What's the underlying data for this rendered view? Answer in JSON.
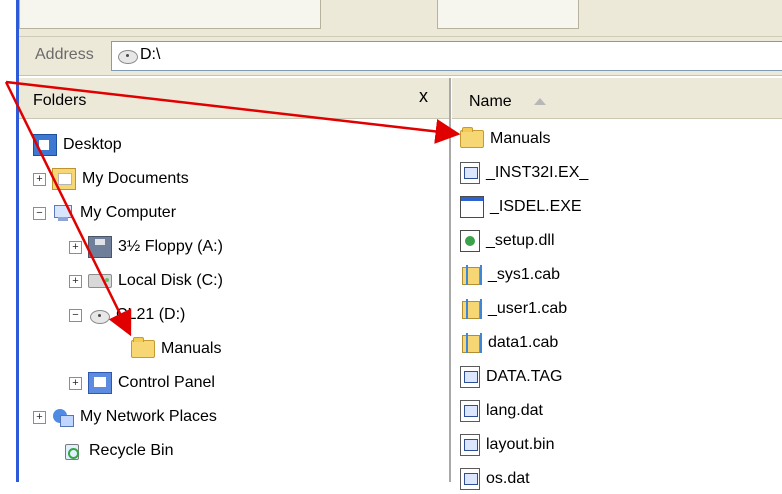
{
  "address": {
    "label": "Address",
    "path": "D:\\"
  },
  "folders": {
    "title": "Folders",
    "close": "x",
    "items": [
      {
        "label": "Desktop",
        "icon": "desktop-icon"
      },
      {
        "label": "My Documents",
        "icon": "folder-documents-icon"
      },
      {
        "label": "My Computer",
        "icon": "computer-icon"
      },
      {
        "label": "3½ Floppy (A:)",
        "icon": "floppy-icon"
      },
      {
        "label": "Local Disk (C:)",
        "icon": "hard-disk-icon"
      },
      {
        "label": "CL21 (D:)",
        "icon": "cd-drive-icon"
      },
      {
        "label": "Manuals",
        "icon": "folder-icon"
      },
      {
        "label": "Control Panel",
        "icon": "control-panel-icon"
      },
      {
        "label": "My Network Places",
        "icon": "network-icon"
      },
      {
        "label": "Recycle Bin",
        "icon": "recycle-bin-icon"
      }
    ]
  },
  "files": {
    "column": "Name",
    "items": [
      {
        "name": "Manuals",
        "icon": "folder-icon"
      },
      {
        "name": "_INST32I.EX_",
        "icon": "file-icon"
      },
      {
        "name": "_ISDEL.EXE",
        "icon": "exe-icon"
      },
      {
        "name": "_setup.dll",
        "icon": "dll-icon"
      },
      {
        "name": "_sys1.cab",
        "icon": "cab-icon"
      },
      {
        "name": "_user1.cab",
        "icon": "cab-icon"
      },
      {
        "name": "data1.cab",
        "icon": "cab-icon"
      },
      {
        "name": "DATA.TAG",
        "icon": "file-icon"
      },
      {
        "name": "lang.dat",
        "icon": "file-icon"
      },
      {
        "name": "layout.bin",
        "icon": "file-icon"
      },
      {
        "name": "os.dat",
        "icon": "file-icon"
      }
    ]
  },
  "colors": {
    "annotation_arrow": "#e00000",
    "xp_blue": "#2d5ad8"
  }
}
